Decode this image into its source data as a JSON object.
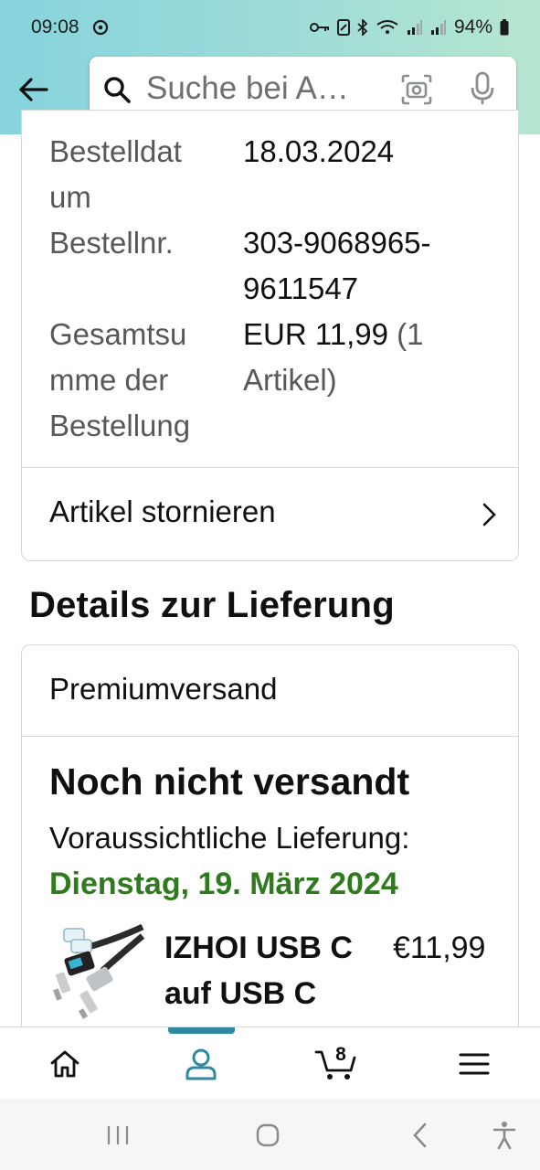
{
  "status_bar": {
    "time": "09:08",
    "battery": "94%"
  },
  "search": {
    "placeholder": "Suche bei A…"
  },
  "order_info": {
    "rows": [
      {
        "label": "Bestelldat um",
        "value": "18.03.2024"
      },
      {
        "label": "Bestellnr.",
        "value": "303-9068965-9611547"
      },
      {
        "label": "Gesamtsu mme der Bestellung",
        "value_main": "EUR 11,99",
        "value_muted": " (1 Artikel)"
      }
    ],
    "cancel_label": "Artikel stornieren"
  },
  "delivery": {
    "section_title": "Details zur Lieferung",
    "shipping_type": "Premiumversand",
    "status": "Noch nicht versandt",
    "expected_label": "Voraussichtliche Lieferung:",
    "expected_date": "Dienstag, 19. März 2024",
    "date_color": "#2f7a1e",
    "product": {
      "title": "IZHOI USB C auf USB C",
      "price": "€11,99"
    }
  },
  "bottom_nav": {
    "items": [
      "home-icon",
      "account-icon",
      "cart-icon",
      "menu-icon"
    ],
    "active": "account-icon",
    "cart_count": "8",
    "accent": "#2f8aa0"
  },
  "colors": {
    "header_start": "#86d3dc",
    "header_end": "#b6e6cf",
    "text": "#0f1111",
    "muted": "#565959"
  }
}
